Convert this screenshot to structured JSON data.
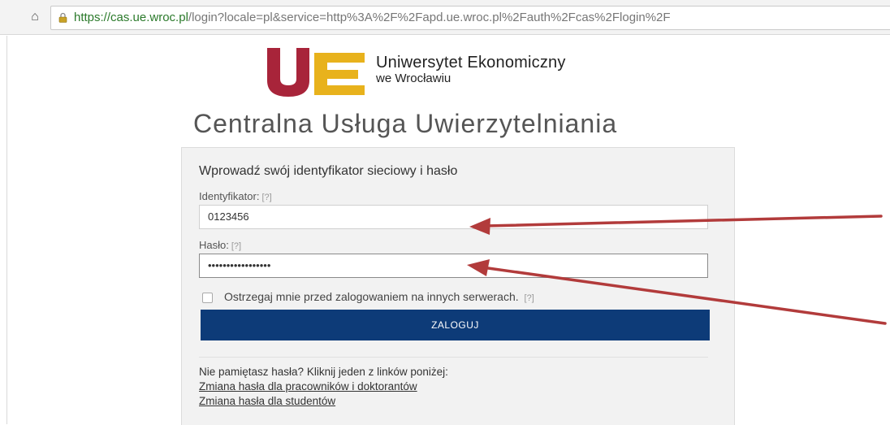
{
  "browser": {
    "url_host": "https://cas.ue.wroc.pl",
    "url_path": "/login?locale=pl&service=http%3A%2F%2Fapd.ue.wroc.pl%2Fauth%2Fcas%2Flogin%2F"
  },
  "logo": {
    "name": "Uniwersytet Ekonomiczny",
    "sub": "we Wrocławiu",
    "colors": {
      "u": "#a8243a",
      "e": "#e8b21c"
    }
  },
  "page_title": "Centralna Usługa Uwierzytelniania",
  "login": {
    "heading": "Wprowadź swój identyfikator sieciowy i hasło",
    "id_label": "Identyfikator:",
    "id_help": "[?]",
    "id_value": "0123456",
    "pass_label": "Hasło:",
    "pass_help": "[?]",
    "pass_value": "•••••••••••••••••",
    "warn_label": "Ostrzegaj mnie przed zalogowaniem na innych serwerach.",
    "warn_help": "[?]",
    "submit_label": "ZALOGUJ",
    "submit_color": "#0d3b78"
  },
  "forgot": {
    "text": "Nie pamiętasz hasła? Kliknij jeden z linków poniżej:",
    "link_staff": "Zmiana hasła dla pracowników i doktorantów",
    "link_students": "Zmiana hasła dla studentów"
  },
  "annotation": {
    "arrow_color": "#b23b3b"
  }
}
